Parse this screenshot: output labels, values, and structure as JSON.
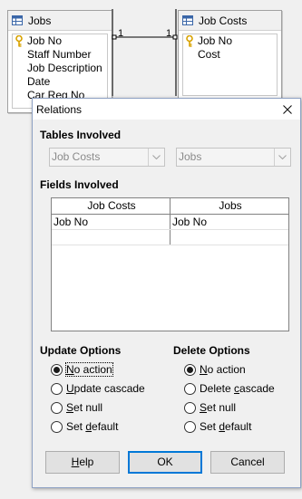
{
  "background": {
    "left_table": {
      "title": "Jobs",
      "fields": [
        {
          "name": "Job No",
          "key": true
        },
        {
          "name": "Staff Number",
          "key": false
        },
        {
          "name": "Job Description",
          "key": false
        },
        {
          "name": "Date",
          "key": false
        },
        {
          "name": "Car Reg No",
          "key": false
        }
      ]
    },
    "right_table": {
      "title": "Job Costs",
      "fields": [
        {
          "name": "Job No",
          "key": true
        },
        {
          "name": "Cost",
          "key": false
        }
      ]
    },
    "relation": {
      "left_cardinality": "1",
      "right_cardinality": "1"
    }
  },
  "dialog": {
    "title": "Relations",
    "tables_involved": {
      "label": "Tables Involved",
      "left_table": "Job Costs",
      "right_table": "Jobs"
    },
    "fields_involved": {
      "label": "Fields Involved",
      "columns": [
        "Job Costs",
        "Jobs"
      ],
      "rows": [
        [
          "Job No",
          "Job No"
        ],
        [
          "",
          ""
        ]
      ]
    },
    "update_options": {
      "label": "Update Options",
      "options": [
        {
          "pre": "",
          "key": "N",
          "post": "o action",
          "selected": true
        },
        {
          "pre": "",
          "key": "U",
          "post": "pdate cascade",
          "selected": false
        },
        {
          "pre": "",
          "key": "S",
          "post": "et null",
          "selected": false
        },
        {
          "pre": "Set ",
          "key": "d",
          "post": "efault",
          "selected": false
        }
      ]
    },
    "delete_options": {
      "label": "Delete Options",
      "options": [
        {
          "pre": "",
          "key": "N",
          "post": "o action",
          "selected": true
        },
        {
          "pre": "Delete ",
          "key": "c",
          "post": "ascade",
          "selected": false
        },
        {
          "pre": "",
          "key": "S",
          "post": "et null",
          "selected": false
        },
        {
          "pre": "Set ",
          "key": "d",
          "post": "efault",
          "selected": false
        }
      ]
    },
    "buttons": {
      "help": {
        "pre": "",
        "key": "H",
        "post": "elp"
      },
      "ok": "OK",
      "cancel": "Cancel"
    }
  },
  "colors": {
    "focus_border": "#0078d7",
    "key_icon": "#d8a200"
  }
}
